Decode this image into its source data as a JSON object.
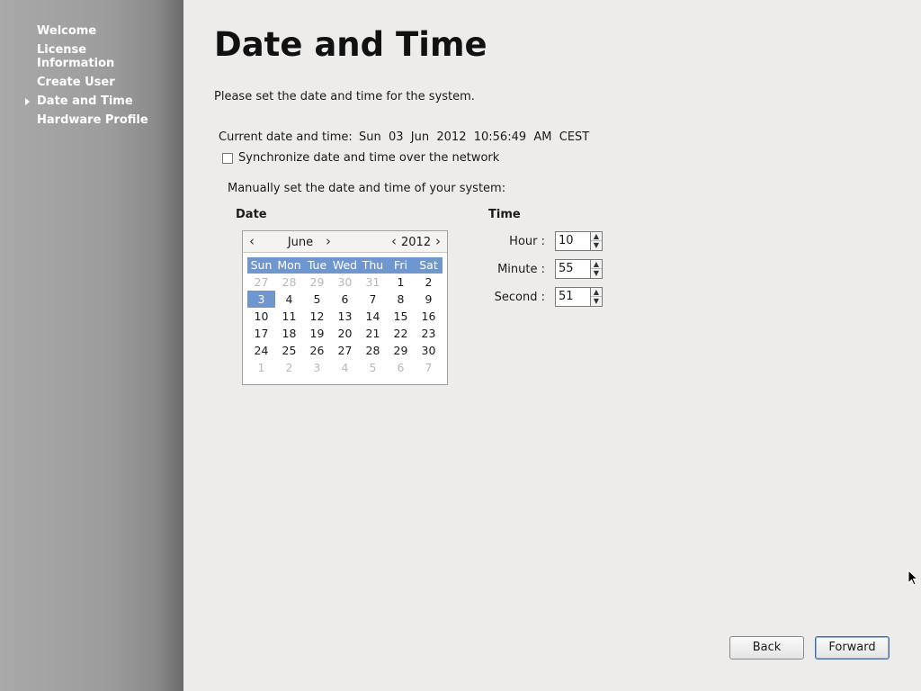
{
  "sidebar": {
    "items": [
      {
        "label": "Welcome"
      },
      {
        "label": "License Information"
      },
      {
        "label": "Create User"
      },
      {
        "label": "Date and Time",
        "active": true
      },
      {
        "label": "Hardware Profile"
      }
    ]
  },
  "page": {
    "title": "Date and Time",
    "intro": "Please set the date and time for the system.",
    "current_label": "Current date and time:",
    "current_value": "Sun  03  Jun  2012  10:56:49  AM  CEST",
    "sync_label": "Synchronize date and time over the network",
    "sync_checked": false,
    "manual_label": "Manually set the date and time of your system:"
  },
  "date": {
    "heading": "Date",
    "month": "June",
    "year": "2012",
    "prev_month": "‹",
    "next_month": "›",
    "prev_year": "‹",
    "next_year": "›",
    "weekdays": [
      "Sun",
      "Mon",
      "Tue",
      "Wed",
      "Thu",
      "Fri",
      "Sat"
    ],
    "weeks": [
      [
        {
          "d": "27",
          "o": true
        },
        {
          "d": "28",
          "o": true
        },
        {
          "d": "29",
          "o": true
        },
        {
          "d": "30",
          "o": true
        },
        {
          "d": "31",
          "o": true
        },
        {
          "d": "1"
        },
        {
          "d": "2"
        }
      ],
      [
        {
          "d": "3",
          "s": true
        },
        {
          "d": "4"
        },
        {
          "d": "5"
        },
        {
          "d": "6"
        },
        {
          "d": "7"
        },
        {
          "d": "8"
        },
        {
          "d": "9"
        }
      ],
      [
        {
          "d": "10"
        },
        {
          "d": "11"
        },
        {
          "d": "12"
        },
        {
          "d": "13"
        },
        {
          "d": "14"
        },
        {
          "d": "15"
        },
        {
          "d": "16"
        }
      ],
      [
        {
          "d": "17"
        },
        {
          "d": "18"
        },
        {
          "d": "19"
        },
        {
          "d": "20"
        },
        {
          "d": "21"
        },
        {
          "d": "22"
        },
        {
          "d": "23"
        }
      ],
      [
        {
          "d": "24"
        },
        {
          "d": "25"
        },
        {
          "d": "26"
        },
        {
          "d": "27"
        },
        {
          "d": "28"
        },
        {
          "d": "29"
        },
        {
          "d": "30"
        }
      ],
      [
        {
          "d": "1",
          "o": true
        },
        {
          "d": "2",
          "o": true
        },
        {
          "d": "3",
          "o": true
        },
        {
          "d": "4",
          "o": true
        },
        {
          "d": "5",
          "o": true
        },
        {
          "d": "6",
          "o": true
        },
        {
          "d": "7",
          "o": true
        }
      ]
    ]
  },
  "time": {
    "heading": "Time",
    "hour_label": "Hour :",
    "hour": "10",
    "minute_label": "Minute :",
    "minute": "55",
    "second_label": "Second :",
    "second": "51"
  },
  "buttons": {
    "back": "Back",
    "forward": "Forward"
  },
  "colors": {
    "selection": "#6f97cf",
    "sidebar": "#9c9c9c"
  }
}
